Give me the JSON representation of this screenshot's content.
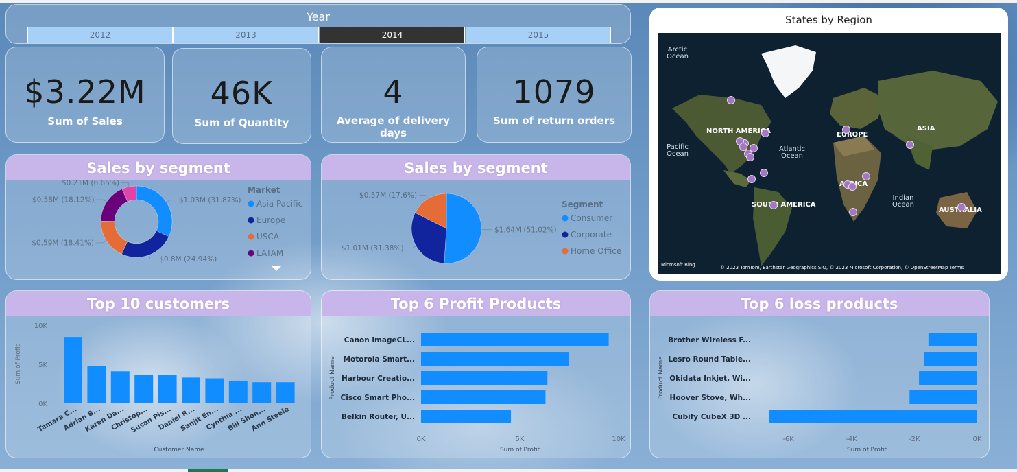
{
  "year_slicer": {
    "title": "Year",
    "options": [
      "2012",
      "2013",
      "2014",
      "2015"
    ],
    "selected": "2014"
  },
  "kpis": [
    {
      "value": "$3.22M",
      "label": "Sum of Sales"
    },
    {
      "value": "46K",
      "label": "Sum of Quantity"
    },
    {
      "value": "4",
      "label": "Average of delivery days"
    },
    {
      "value": "1079",
      "label": "Sum of return orders"
    }
  ],
  "map": {
    "title": "States by Region",
    "labels": [
      "NORTH AMERICA",
      "EUROPE",
      "ASIA",
      "AFRICA",
      "SOUTH AMERICA",
      "AUSTRALIA"
    ],
    "seas": [
      "Arctic Ocean",
      "Pacific Ocean",
      "Atlantic Ocean",
      "Indian Ocean"
    ],
    "copyright": "© 2023 TomTom, Earthstar Geographics SIO, © 2023 Microsoft Corporation, © OpenStreetMap  Terms",
    "bing": "Microsoft Bing"
  },
  "chart_data": [
    {
      "type": "pie",
      "title": "Sales by segment",
      "donut": true,
      "legend_title": "Market",
      "legend_position": "right",
      "slices": [
        {
          "name": "Asia Pacific",
          "label": "$1.03M (31.87%)",
          "value": 31.87,
          "color": "#118dff"
        },
        {
          "name": "Europe",
          "label": "$0.8M (24.94%)",
          "value": 24.94,
          "color": "#12239e"
        },
        {
          "name": "USCA",
          "label": "$0.59M (18.41%)",
          "value": 18.41,
          "color": "#e66c37"
        },
        {
          "name": "LATAM",
          "label": "$0.58M (18.12%)",
          "value": 18.12,
          "color": "#6b007b"
        },
        {
          "name": "",
          "label": "$0.21M (6.65%)",
          "value": 6.65,
          "color": "#e044a7"
        }
      ]
    },
    {
      "type": "pie",
      "title": "Sales by segment",
      "donut": false,
      "legend_title": "Segment",
      "legend_position": "right",
      "slices": [
        {
          "name": "Consumer",
          "label": "$1.64M (51.02%)",
          "value": 51.02,
          "color": "#118dff"
        },
        {
          "name": "Corporate",
          "label": "$1.01M (31.38%)",
          "value": 31.38,
          "color": "#12239e"
        },
        {
          "name": "Home Office",
          "label": "$0.57M (17.6%)",
          "value": 17.6,
          "color": "#e66c37"
        }
      ]
    },
    {
      "type": "bar",
      "title": "Top 10 customers",
      "xlabel": "Customer Name",
      "ylabel": "Sum of Profit",
      "ylim": [
        0,
        10000
      ],
      "yticks": [
        "0K",
        "5K",
        "10K"
      ],
      "color": "#118dff",
      "categories": [
        "Tamara C...",
        "Adrian B...",
        "Karen Da...",
        "Christop...",
        "Susan Pis...",
        "Daniel R...",
        "Sanjit En...",
        "Cynthia ...",
        "Bill Shon...",
        "Ann Steele"
      ],
      "values": [
        8500,
        4800,
        4100,
        3600,
        3600,
        3300,
        3200,
        2900,
        2700,
        2700
      ]
    },
    {
      "type": "bar",
      "orientation": "horizontal",
      "title": "Top 6 Profit Products",
      "xlabel": "Sum of Profit",
      "ylabel": "Product Name",
      "xlim": [
        0,
        10000
      ],
      "xticks": [
        "0K",
        "5K",
        "10K"
      ],
      "color": "#118dff",
      "categories": [
        "Canon imageCL...",
        "Motorola Smart...",
        "Harbour Creatio...",
        "Cisco Smart Pho...",
        "Belkin Router, U..."
      ],
      "values": [
        9500,
        7500,
        6400,
        6300,
        4550
      ]
    },
    {
      "type": "bar",
      "orientation": "horizontal",
      "title": "Top 6 loss products",
      "xlabel": "Sum of Profit",
      "ylabel": "Product Name",
      "xlim": [
        -6600,
        0
      ],
      "xticks": [
        "-6K",
        "-4K",
        "-2K",
        "0K"
      ],
      "color": "#118dff",
      "categories": [
        "Brother Wireless F...",
        "Lesro Round Table...",
        "Okidata Inkjet, Wi...",
        "Hoover Stove, Wh...",
        "Cubify CubeX 3D ..."
      ],
      "values": [
        -1550,
        -1700,
        -1850,
        -2150,
        -6600
      ]
    }
  ]
}
